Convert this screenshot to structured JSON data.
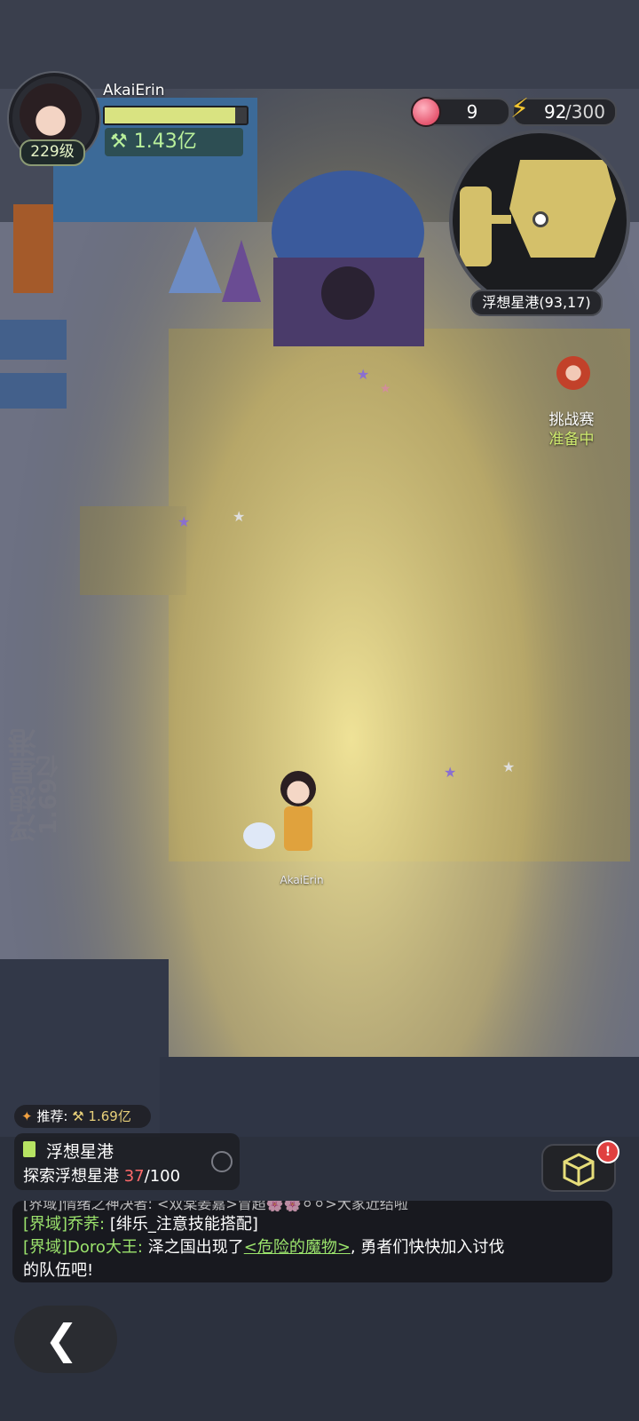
{
  "player": {
    "name": "AkaiErin",
    "level": "229级",
    "power": "1.43亿",
    "hp_fraction": 0.92
  },
  "resources": {
    "peach": "9",
    "energy_current": "92",
    "energy_max": "300"
  },
  "minimap": {
    "location": "浮想星港(93,17)"
  },
  "challenge": {
    "title": "挑战赛",
    "status": "准备中"
  },
  "map_label": {
    "zone": "浮想星港",
    "power": "1.69亿"
  },
  "character": {
    "label": "AkaiErin"
  },
  "recommend": {
    "prefix": "推荐:",
    "value": "1.69亿"
  },
  "quest": {
    "title": "浮想星港",
    "desc_prefix": "探索浮想星港 ",
    "current": "37",
    "total": "/100"
  },
  "chat": {
    "line0": "[界域]情绪之神决者: <双棠姜嘉>冒超🌸🌸⚪⚪>大家近结啦",
    "line1_tag": "[界域]",
    "line1_name": "乔荞:",
    "line1_text": " [绯乐_注意技能搭配]",
    "line2_tag": "[界域]",
    "line2_name": "Doro大王:",
    "line2_text_a": " 泽之国出现了",
    "line2_link": "<危险的魔物>",
    "line2_text_b": ", 勇者们快快加入讨伐",
    "line3": "的队伍吧!"
  },
  "notification_badge": "!",
  "colors": {
    "accent_green": "#9be36c",
    "quest_red": "#ff6b6b",
    "hp_yellow": "#d9e381"
  }
}
